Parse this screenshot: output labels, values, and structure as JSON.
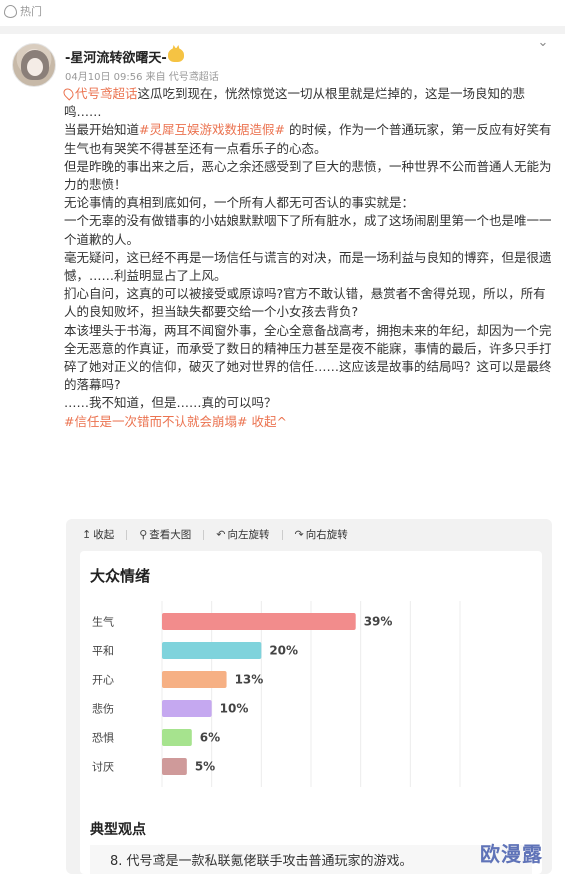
{
  "topbar": {
    "label": "热门",
    "icon": "fire-icon"
  },
  "post": {
    "username": "-星河流转欲曙天-",
    "meta": "04月10日 09:56  来自 代号鸢超话",
    "lines": [
      {
        "tag": "代号鸢超话",
        "text": "这瓜吃到现在，恍然惊觉这一切从根里就是烂掉的，这是一场良知的悲鸣……"
      },
      {
        "pre": "当最开始知道",
        "tag": "#灵犀互娱游戏数据造假#",
        "text": " 的时候，作为一个普通玩家，第一反应有好笑有生气也有哭笑不得甚至还有一点看乐子的心态。"
      },
      {
        "text": "但是昨晚的事出来之后，恶心之余还感受到了巨大的悲愤，一种世界不公而普通人无能为力的悲愤！"
      },
      {
        "text": "无论事情的真相到底如何，一个所有人都无可否认的事实就是："
      },
      {
        "text": "一个无辜的没有做错事的小姑娘默默咽下了所有脏水，成了这场闹剧里第一个也是唯一一个道歉的人。"
      },
      {
        "text": "毫无疑问，这已经不再是一场信任与谎言的对决，而是一场利益与良知的博弈，但是很遗憾，……利益明显占了上风。"
      },
      {
        "text": "扪心自问，这真的可以被接受或原谅吗?官方不敢认错，悬赏者不舍得兑现，所以，所有人的良知败坏，担当缺失都要交给一个小女孩去背负?"
      },
      {
        "text": "本该埋头于书海，两耳不闻窗外事，全心全意备战高考，拥抱未来的年纪，却因为一个完全无恶意的作真证，而承受了数日的精神压力甚至是夜不能寐，事情的最后，许多只手打碎了她对正义的信仰，破灭了她对世界的信任……这应该是故事的结局吗？这可以是最终的落幕吗?"
      },
      {
        "text": "……我不知道，但是……真的可以吗？"
      }
    ],
    "footer_tag": "#信任是一次错而不认就会崩塌#",
    "collapse": "收起^"
  },
  "toolbar": {
    "collapse": "收起",
    "view_large": "查看大图",
    "rotate_left": "向左旋转",
    "rotate_right": "向右旋转"
  },
  "card": {
    "title": "大众情绪",
    "opinion_title": "典型观点",
    "quote": "8. 代号鸢是一款私联氪佬联手攻击普通玩家的游戏。"
  },
  "chart_data": {
    "type": "bar",
    "orientation": "horizontal",
    "categories": [
      "生气",
      "平和",
      "开心",
      "悲伤",
      "恐惧",
      "讨厌"
    ],
    "values": [
      39,
      20,
      13,
      10,
      6,
      5
    ],
    "value_labels": [
      "39%",
      "20%",
      "13%",
      "10%",
      "6%",
      "5%"
    ],
    "colors": [
      "#f28c8c",
      "#7fd3dc",
      "#f6b084",
      "#c5a8f0",
      "#a6e38e",
      "#cf9a9a"
    ],
    "xlim": [
      0,
      60
    ],
    "grid": true
  },
  "watermark": "欧漫露"
}
